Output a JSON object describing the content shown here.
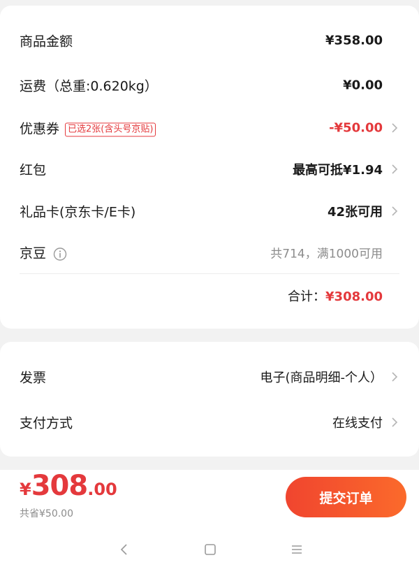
{
  "summary": {
    "goods_amount": {
      "label": "商品金额",
      "value": "¥358.00"
    },
    "shipping": {
      "label": "运费（总重:0.620kg）",
      "value": "¥0.00"
    },
    "coupon": {
      "label": "优惠券",
      "tag": "已选2张(含头号京贴)",
      "value": "-¥50.00"
    },
    "red_packet": {
      "label": "红包",
      "value": "最高可抵¥1.94"
    },
    "gift_card": {
      "label": "礼品卡(京东卡/E卡)",
      "value": "42张可用"
    },
    "jd_beans": {
      "label": "京豆",
      "value": "共714，满1000可用"
    },
    "total": {
      "label": "合计：",
      "value": "¥308.00"
    }
  },
  "invoice": {
    "label": "发票",
    "value": "电子(商品明细-个人）"
  },
  "payment": {
    "label": "支付方式",
    "value": "在线支付"
  },
  "bottom": {
    "price_currency": "¥",
    "price_integer": "308",
    "price_decimal": ".00",
    "saved": "共省¥50.00",
    "submit_label": "提交订单"
  },
  "colors": {
    "accent": "#e4393c",
    "button_start": "#f0452f",
    "button_end": "#fb6a2b"
  },
  "icons": [
    "chevron-right-icon",
    "info-icon",
    "back-icon",
    "home-icon",
    "menu-icon"
  ]
}
